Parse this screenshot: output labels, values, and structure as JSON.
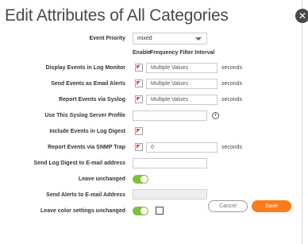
{
  "dialog": {
    "title": "Edit Attributes of All Categories",
    "close_label": "✕"
  },
  "event_priority": {
    "label": "Event Priority",
    "value": "mixed"
  },
  "columns": {
    "enable": "Enable",
    "frequency": "Frequency Filter Interval"
  },
  "rows": {
    "display_events": {
      "label": "Display Events in Log Monitor",
      "value": "Multiple Values",
      "unit": "seconds"
    },
    "email_alerts": {
      "label": "Send Events as Email Alerts",
      "value": "Multiple Values",
      "unit": "seconds"
    },
    "syslog": {
      "label": "Report Events via Syslog",
      "value": "Multiple Values",
      "unit": "seconds"
    },
    "syslog_profile": {
      "label": "Use This Syslog Server Profile",
      "value": "",
      "info_icon": "i"
    },
    "log_digest": {
      "label": "Include Events in Log Digest"
    },
    "snmp": {
      "label": "Report Events via SNMP Trap",
      "value": "0",
      "unit": "seconds"
    },
    "digest_email": {
      "label": "Send Log Digest to E-mail address",
      "value": ""
    },
    "leave_unchanged": {
      "label": "Leave unchanged",
      "on": true
    },
    "alerts_email": {
      "label": "Send Alerts to E-mail Address",
      "value": ""
    },
    "color_settings": {
      "label": "Leave color settings unchanged",
      "on": true,
      "checked": false
    }
  },
  "buttons": {
    "cancel": "Cancel",
    "save": "Save"
  },
  "colors": {
    "accent": "#ff7a1a",
    "toggle_on": "#7fbf3f",
    "flag": "#e8521f"
  }
}
